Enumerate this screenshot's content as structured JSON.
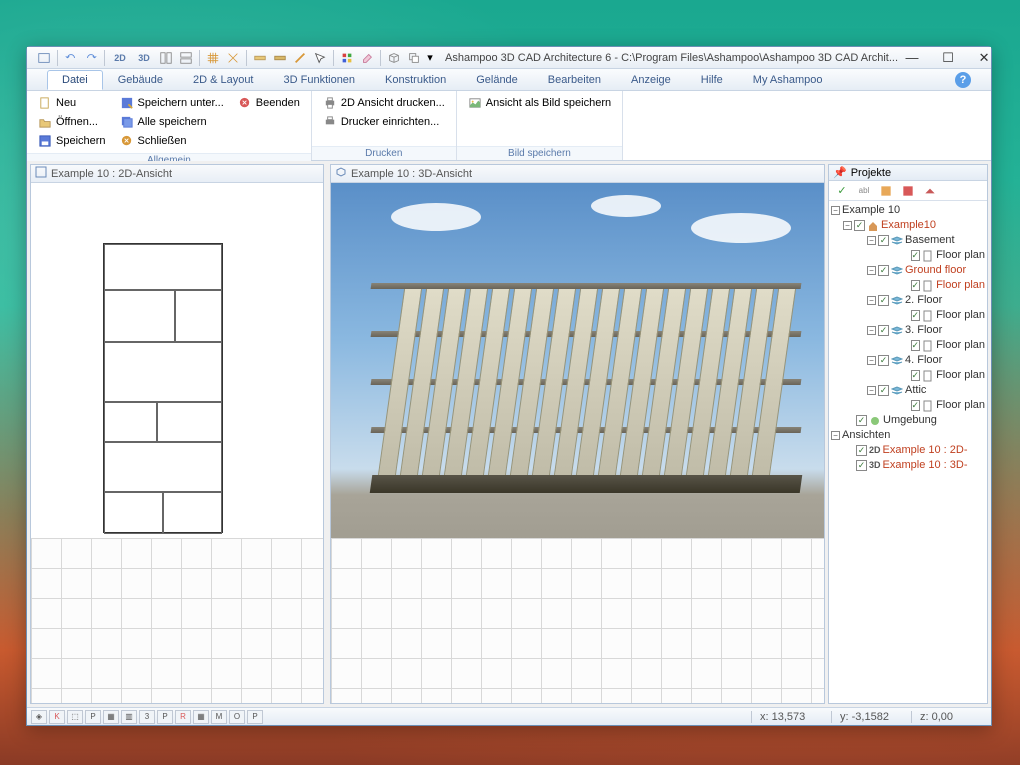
{
  "title": "Ashampoo 3D CAD Architecture 6 - C:\\Program Files\\Ashampoo\\Ashampoo 3D CAD Archit...",
  "menu": {
    "tabs": [
      "Datei",
      "Gebäude",
      "2D & Layout",
      "3D Funktionen",
      "Konstruktion",
      "Gelände",
      "Bearbeiten",
      "Anzeige",
      "Hilfe",
      "My Ashampoo"
    ],
    "active": 0
  },
  "ribbon": {
    "groups": [
      {
        "label": "Allgemein",
        "cols": [
          [
            {
              "icon": "new",
              "text": "Neu"
            },
            {
              "icon": "open",
              "text": "Öffnen..."
            },
            {
              "icon": "save",
              "text": "Speichern"
            }
          ],
          [
            {
              "icon": "saveas",
              "text": "Speichern unter..."
            },
            {
              "icon": "saveall",
              "text": "Alle speichern"
            },
            {
              "icon": "close",
              "text": "Schließen"
            }
          ],
          [
            {
              "icon": "exit",
              "text": "Beenden"
            }
          ]
        ]
      },
      {
        "label": "Drucken",
        "cols": [
          [
            {
              "icon": "print",
              "text": "2D Ansicht drucken..."
            },
            {
              "icon": "printer",
              "text": "Drucker einrichten..."
            }
          ]
        ]
      },
      {
        "label": "Bild speichern",
        "cols": [
          [
            {
              "icon": "image",
              "text": "Ansicht als Bild speichern"
            }
          ]
        ]
      }
    ]
  },
  "views": {
    "v2d": "Example 10 : 2D-Ansicht",
    "v3d": "Example 10 : 3D-Ansicht"
  },
  "tree": {
    "title": "Projekte",
    "root": {
      "label": "Example 10",
      "children": [
        {
          "label": "Example10",
          "sel": true,
          "icon": "house",
          "children": [
            {
              "label": "Basement",
              "icon": "layer",
              "children": [
                {
                  "label": "Floor plan",
                  "icon": "doc",
                  "leaf": true
                }
              ]
            },
            {
              "label": "Ground floor",
              "sel": true,
              "icon": "layer",
              "children": [
                {
                  "label": "Floor plan",
                  "sel": true,
                  "icon": "doc",
                  "leaf": true
                }
              ]
            },
            {
              "label": "2. Floor",
              "icon": "layer",
              "children": [
                {
                  "label": "Floor plan",
                  "icon": "doc",
                  "leaf": true
                }
              ]
            },
            {
              "label": "3. Floor",
              "icon": "layer",
              "children": [
                {
                  "label": "Floor plan",
                  "icon": "doc",
                  "leaf": true
                }
              ]
            },
            {
              "label": "4. Floor",
              "icon": "layer",
              "children": [
                {
                  "label": "Floor plan",
                  "icon": "doc",
                  "leaf": true
                }
              ]
            },
            {
              "label": "Attic",
              "icon": "layer",
              "children": [
                {
                  "label": "Floor plan",
                  "icon": "doc",
                  "leaf": true
                }
              ]
            }
          ]
        },
        {
          "label": "Umgebung",
          "icon": "env",
          "leaf": true
        }
      ]
    },
    "views": {
      "label": "Ansichten",
      "items": [
        {
          "badge": "2D",
          "label": "Example 10 : 2D-",
          "sel": true
        },
        {
          "badge": "3D",
          "label": "Example 10 : 3D-",
          "sel": true
        }
      ]
    }
  },
  "status": {
    "x_label": "x:",
    "x": "13,573",
    "y_label": "y:",
    "y": "-3,1582",
    "z_label": "z:",
    "z": "0,00"
  }
}
